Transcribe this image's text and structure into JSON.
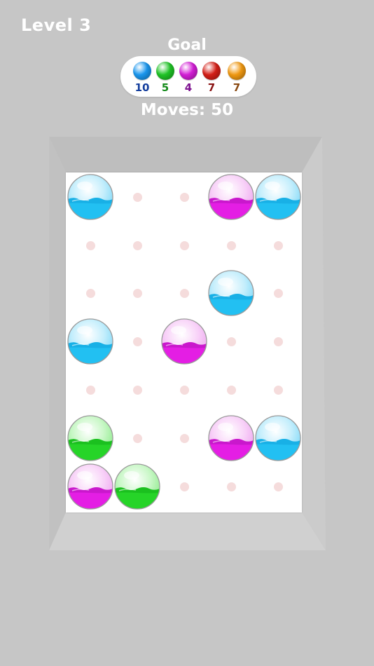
{
  "header": {
    "level": "Level 3",
    "goal_title": "Goal",
    "moves": "Moves: 50"
  },
  "goal": [
    {
      "color": "#1a98f0",
      "count": "10",
      "text_color": "#123c9c",
      "name": "blue"
    },
    {
      "color": "#1fc626",
      "count": "5",
      "text_color": "#148a1a",
      "name": "green"
    },
    {
      "color": "#d51ed8",
      "count": "4",
      "text_color": "#7e1290",
      "name": "magenta"
    },
    {
      "color": "#d61f17",
      "count": "7",
      "text_color": "#8a1414",
      "name": "red"
    },
    {
      "color": "#f29a12",
      "count": "7",
      "text_color": "#8a4a12",
      "name": "orange"
    }
  ],
  "grid": {
    "cols": 5,
    "rows": 7,
    "cells": [
      {
        "row": 0,
        "col": 0,
        "color": "blue"
      },
      {
        "row": 0,
        "col": 3,
        "color": "magenta"
      },
      {
        "row": 0,
        "col": 4,
        "color": "blue"
      },
      {
        "row": 2,
        "col": 3,
        "color": "blue"
      },
      {
        "row": 3,
        "col": 0,
        "color": "blue"
      },
      {
        "row": 3,
        "col": 2,
        "color": "magenta"
      },
      {
        "row": 5,
        "col": 0,
        "color": "green"
      },
      {
        "row": 5,
        "col": 3,
        "color": "magenta"
      },
      {
        "row": 5,
        "col": 4,
        "color": "blue"
      },
      {
        "row": 6,
        "col": 0,
        "color": "magenta"
      },
      {
        "row": 6,
        "col": 1,
        "color": "green"
      }
    ]
  },
  "palette": {
    "blue": {
      "light": "#c4eefc",
      "mid": "#7fd8f7",
      "liquid": "#22c0f2",
      "dark": "#0e9ed6"
    },
    "magenta": {
      "light": "#f8d2f8",
      "mid": "#eea6f0",
      "liquid": "#e41ee4",
      "dark": "#a812b0"
    },
    "green": {
      "light": "#c8f7c6",
      "mid": "#8eeb8c",
      "liquid": "#26d428",
      "dark": "#10a814"
    }
  }
}
